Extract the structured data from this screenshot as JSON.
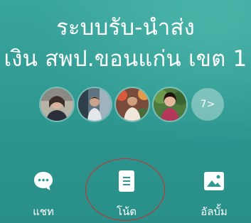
{
  "group": {
    "title_line1": "ระบบรับ-นำส่ง",
    "title_line2": "เงิน สพป.ขอนแก่น เขต 1"
  },
  "members": {
    "avatars": [
      {
        "name": "member-avatar-1"
      },
      {
        "name": "member-avatar-2"
      },
      {
        "name": "member-avatar-3"
      },
      {
        "name": "member-avatar-4"
      }
    ],
    "more_label": "7>"
  },
  "actions": {
    "chat": {
      "label": "แชท",
      "icon": "chat-bubble-icon"
    },
    "note": {
      "label": "โน้ต",
      "icon": "note-document-icon"
    },
    "album": {
      "label": "อัลบั้ม",
      "icon": "album-image-icon"
    }
  },
  "colors": {
    "background": "#2f9a94",
    "text": "#ffffff",
    "annotation_circle": "#c8302a"
  }
}
